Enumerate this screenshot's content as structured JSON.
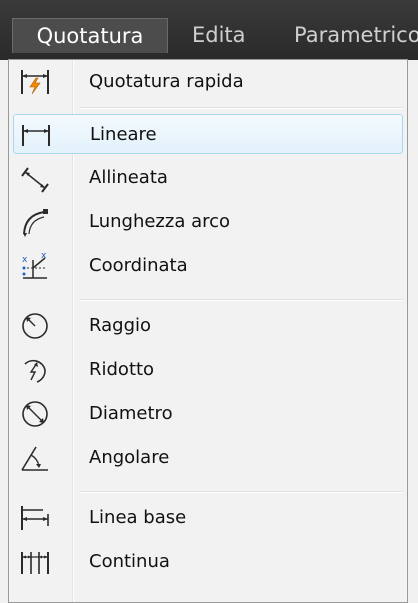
{
  "menubar": {
    "items": [
      {
        "label": "Quotatura"
      },
      {
        "label": "Edita"
      },
      {
        "label": "Parametrico"
      }
    ]
  },
  "menu": {
    "items": [
      {
        "label": "Quotatura rapida",
        "icon": "quick-dimension-icon"
      },
      {
        "label": "Lineare",
        "icon": "linear-dimension-icon",
        "highlighted": true
      },
      {
        "label": "Allineata",
        "icon": "aligned-dimension-icon"
      },
      {
        "label": "Lunghezza arco",
        "icon": "arc-length-icon"
      },
      {
        "label": "Coordinata",
        "icon": "ordinate-dimension-icon"
      },
      {
        "label": "Raggio",
        "icon": "radius-icon"
      },
      {
        "label": "Ridotto",
        "icon": "jogged-radius-icon"
      },
      {
        "label": "Diametro",
        "icon": "diameter-icon"
      },
      {
        "label": "Angolare",
        "icon": "angular-dimension-icon"
      },
      {
        "label": "Linea base",
        "icon": "baseline-dimension-icon"
      },
      {
        "label": "Continua",
        "icon": "continue-dimension-icon"
      }
    ]
  },
  "colors": {
    "menubar_bg": "#2f2f2f",
    "highlight_border": "#a8d8f0",
    "icon_blue": "#2060c0",
    "icon_orange": "#f08a00"
  }
}
